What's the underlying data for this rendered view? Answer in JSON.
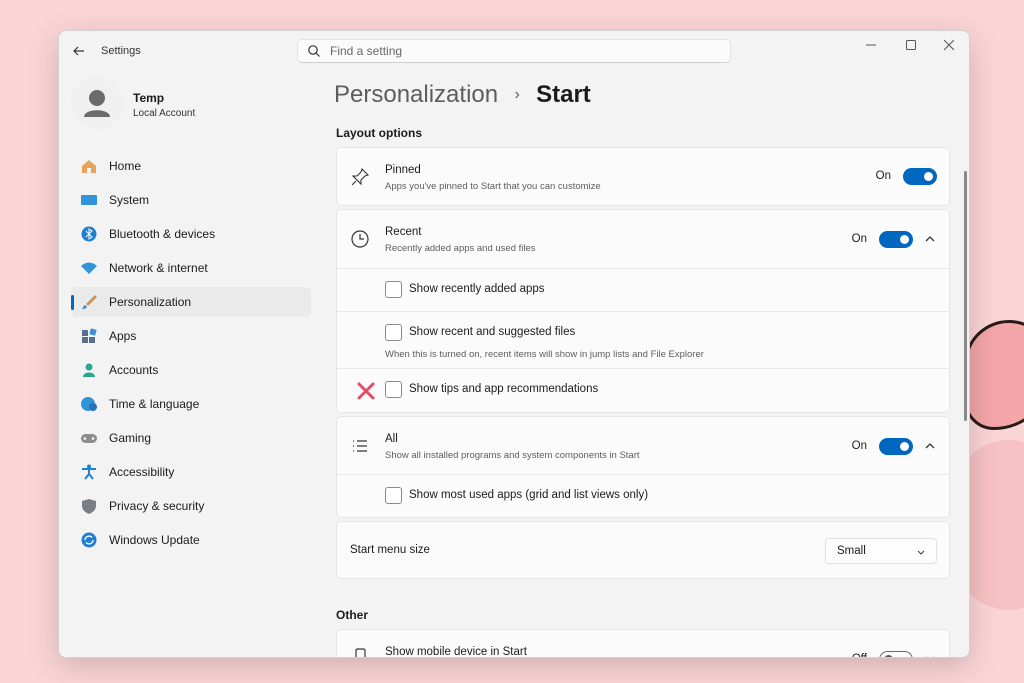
{
  "window": {
    "title": "Settings"
  },
  "search": {
    "placeholder": "Find a setting"
  },
  "profile": {
    "name": "Temp",
    "account_type": "Local Account"
  },
  "sidebar": {
    "items": [
      {
        "label": "Home",
        "icon": "home-icon"
      },
      {
        "label": "System",
        "icon": "system-icon"
      },
      {
        "label": "Bluetooth & devices",
        "icon": "bluetooth-icon"
      },
      {
        "label": "Network & internet",
        "icon": "wifi-icon"
      },
      {
        "label": "Personalization",
        "icon": "brush-icon",
        "active": true
      },
      {
        "label": "Apps",
        "icon": "apps-icon"
      },
      {
        "label": "Accounts",
        "icon": "accounts-icon"
      },
      {
        "label": "Time & language",
        "icon": "globe-clock-icon"
      },
      {
        "label": "Gaming",
        "icon": "gamepad-icon"
      },
      {
        "label": "Accessibility",
        "icon": "accessibility-icon"
      },
      {
        "label": "Privacy & security",
        "icon": "shield-icon"
      },
      {
        "label": "Windows Update",
        "icon": "update-icon"
      }
    ]
  },
  "breadcrumb": {
    "parent": "Personalization",
    "separator": "›",
    "current": "Start"
  },
  "layout_options": {
    "heading": "Layout options",
    "pinned": {
      "title": "Pinned",
      "subtitle": "Apps you've pinned to Start that you can customize",
      "state": "On"
    },
    "recent": {
      "title": "Recent",
      "subtitle": "Recently added apps and used files",
      "state": "On",
      "show_recently_added": "Show recently added apps",
      "show_recent_suggested": "Show recent and suggested files",
      "show_recent_suggested_note": "When this is turned on, recent items will show in jump lists and File Explorer",
      "show_tips": "Show tips and app recommendations"
    },
    "all": {
      "title": "All",
      "subtitle": "Show all installed programs and system components in Start",
      "state": "On",
      "show_most_used": "Show most used apps (grid and list views only)"
    },
    "menu_size": {
      "label": "Start menu size",
      "value": "Small"
    }
  },
  "other": {
    "heading": "Other",
    "mobile_device": {
      "title": "Show mobile device in Start",
      "state": "Off"
    }
  },
  "colors": {
    "accent": "#0067c0",
    "mark": "#e04f6a"
  }
}
